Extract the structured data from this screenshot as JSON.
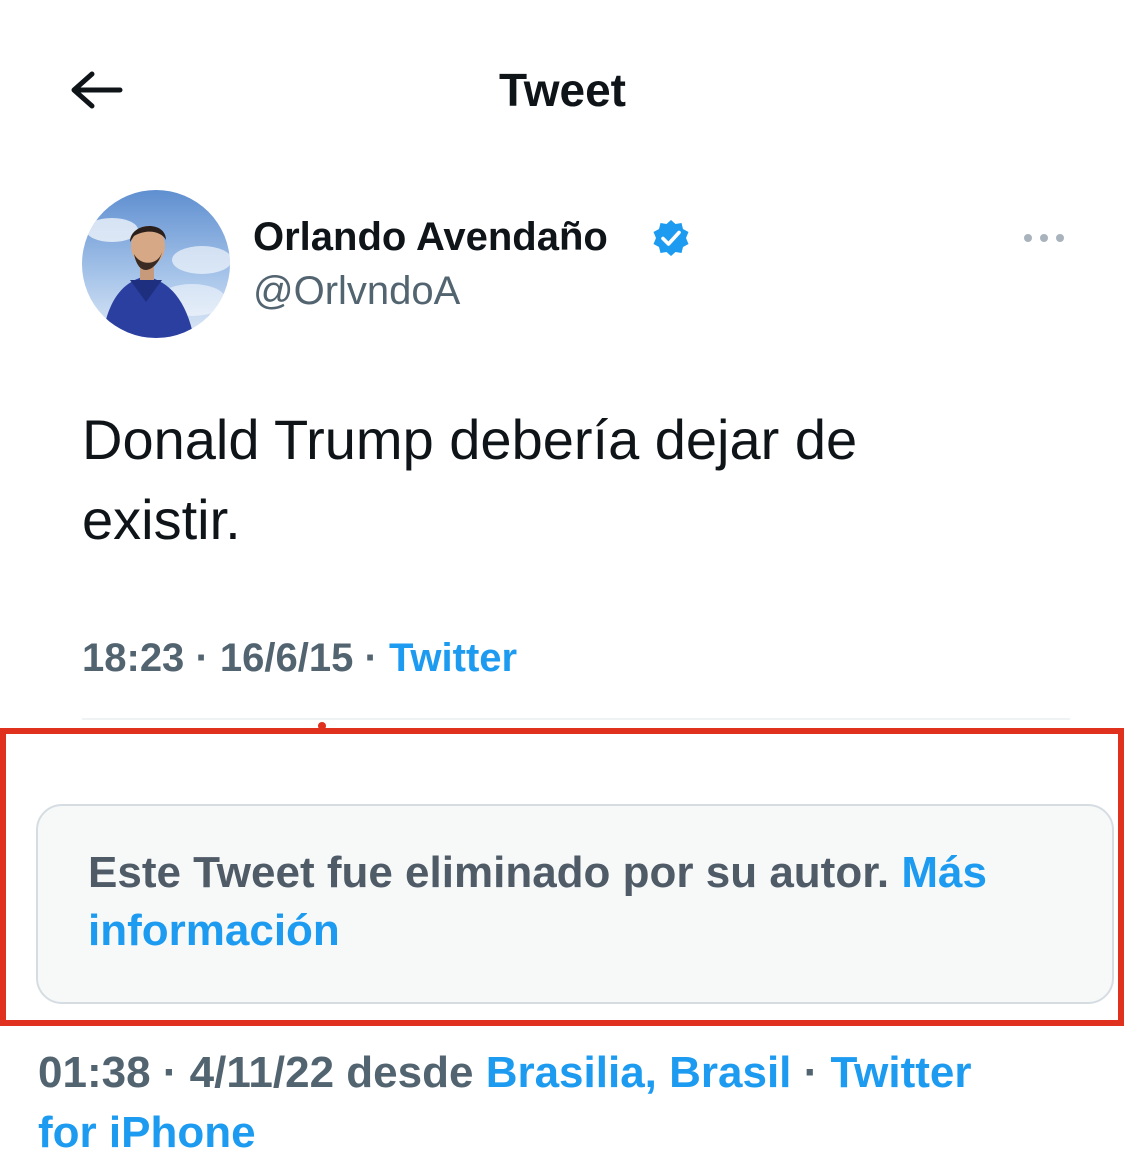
{
  "header": {
    "back_icon": "arrow-left-icon",
    "title": "Tweet"
  },
  "tweet": {
    "display_name": "Orlando Avendaño",
    "verified_icon": "verified-badge-icon",
    "handle": "@OrlvndoA",
    "more_icon": "more-dots-icon",
    "text": "Donald Trump debería dejar de existir.",
    "time": "18:23",
    "date": "16/6/15",
    "separator": "·",
    "source": "Twitter"
  },
  "notice": {
    "text": "Este Tweet fue eliminado por su autor.",
    "link": "Más información"
  },
  "bottom_meta": {
    "time": "01:38",
    "date": "4/11/22",
    "from_label": "desde",
    "location": "Brasilia, Brasil",
    "separator": "·",
    "source": "Twitter",
    "source_continuation": "for iPhone"
  },
  "colors": {
    "link": "#1d9bf0",
    "highlight": "#e0301e",
    "verified": "#1d9bf0"
  }
}
